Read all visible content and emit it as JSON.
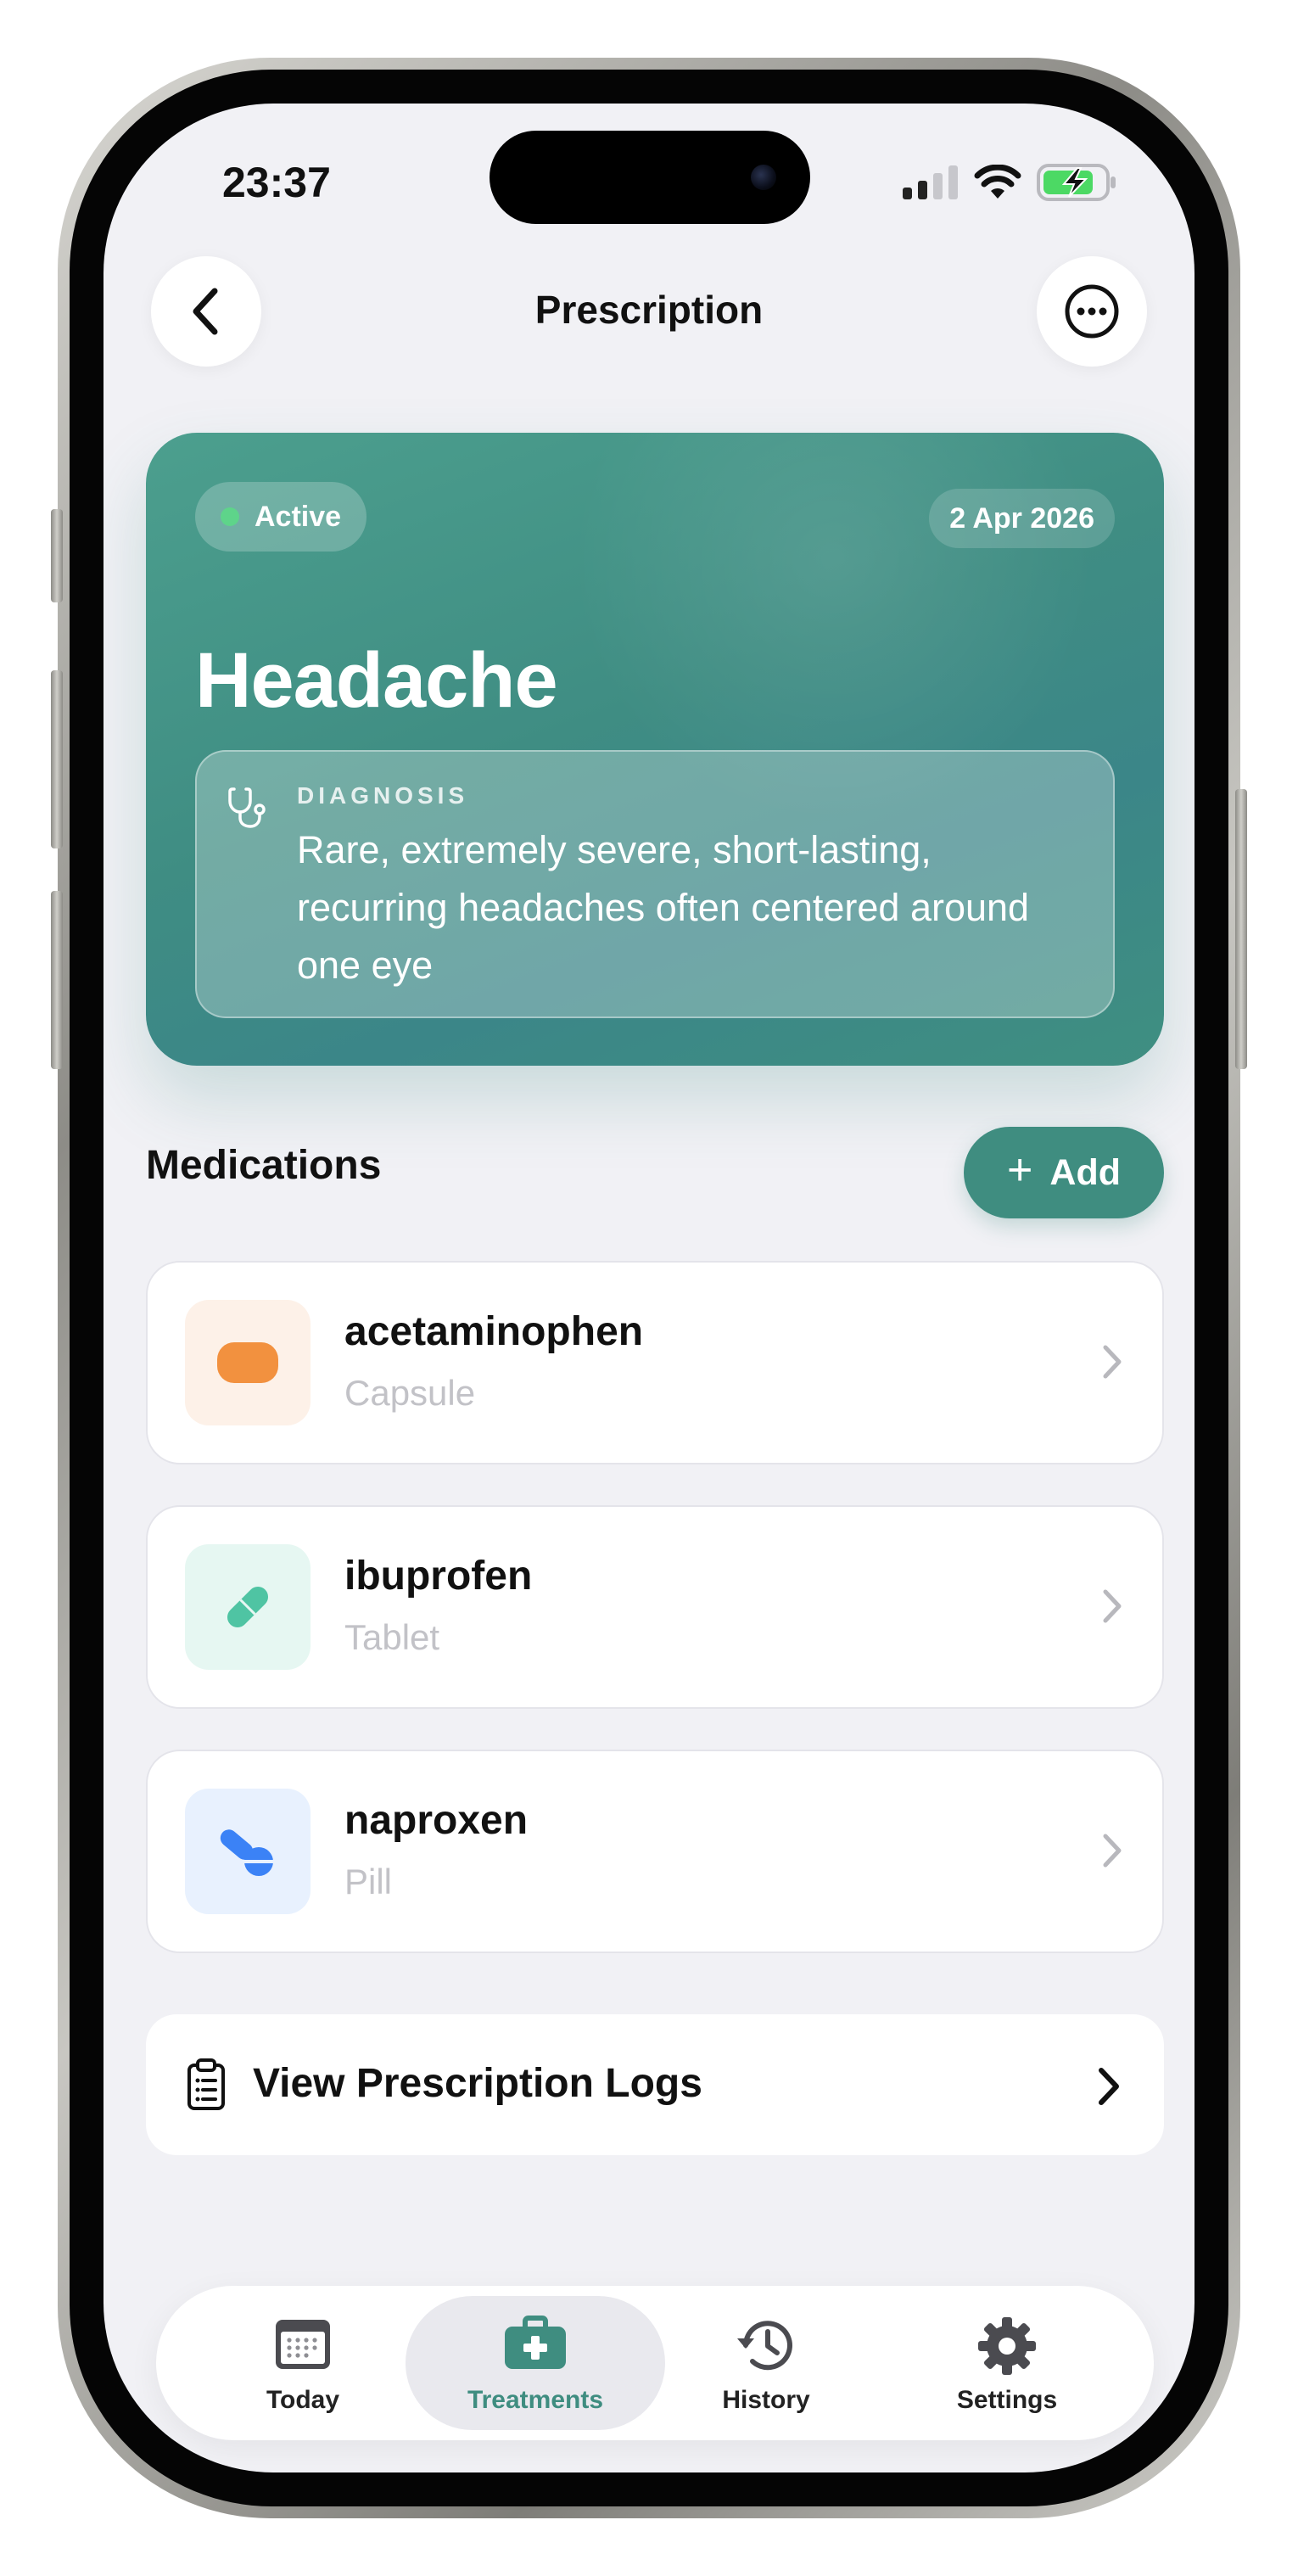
{
  "status_bar": {
    "time": "23:37"
  },
  "header": {
    "title": "Prescription",
    "back_icon": "chevron-left-icon",
    "more_icon": "ellipsis-circle-icon"
  },
  "prescription": {
    "status": "Active",
    "date": "2 Apr 2026",
    "title": "Headache",
    "diagnosis_label": "DIAGNOSIS",
    "diagnosis_text": "Rare, extremely severe, short-lasting, recurring headaches often centered around one eye",
    "colors": {
      "card": "#3f8d83",
      "status_dot": "#5ed48a"
    }
  },
  "medications": {
    "section_title": "Medications",
    "add_label": "Add",
    "items": [
      {
        "name": "acetaminophen",
        "type": "Capsule",
        "icon": "capsule-icon",
        "color": "#f2913f",
        "bg": "#fdf1e8"
      },
      {
        "name": "ibuprofen",
        "type": "Tablet",
        "icon": "tablet-icon",
        "color": "#4fc4a3",
        "bg": "#e6f7f2"
      },
      {
        "name": "naproxen",
        "type": "Pill",
        "icon": "pill-icon",
        "color": "#3b82f6",
        "bg": "#e8f1fe"
      }
    ]
  },
  "logs": {
    "label": "View Prescription Logs",
    "icon": "clipboard-list-icon"
  },
  "tabbar": {
    "active": "Treatments",
    "accent": "#3f8d80",
    "items": [
      {
        "label": "Today",
        "icon": "calendar-icon"
      },
      {
        "label": "Treatments",
        "icon": "medical-kit-icon"
      },
      {
        "label": "History",
        "icon": "history-icon"
      },
      {
        "label": "Settings",
        "icon": "gear-icon"
      }
    ]
  }
}
